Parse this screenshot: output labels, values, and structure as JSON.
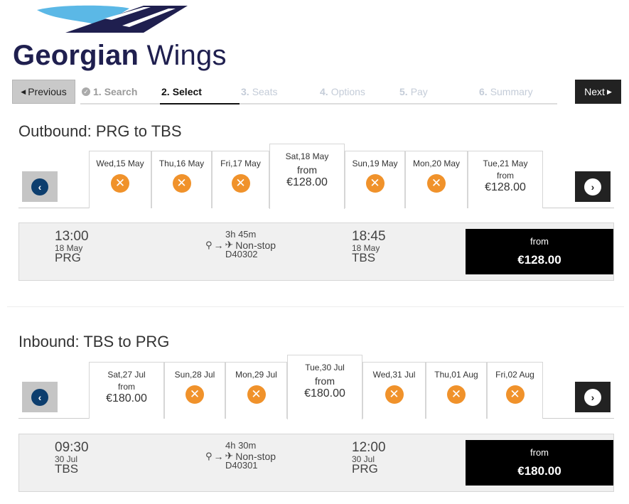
{
  "brand": {
    "name_bold": "Georgian",
    "name_light": "Wings"
  },
  "nav": {
    "previous_label": "Previous",
    "next_label": "Next",
    "steps": [
      {
        "num": "1.",
        "label": "Search",
        "state": "done"
      },
      {
        "num": "2.",
        "label": "Select",
        "state": "current"
      },
      {
        "num": "3.",
        "label": "Seats",
        "state": "todo"
      },
      {
        "num": "4.",
        "label": "Options",
        "state": "todo"
      },
      {
        "num": "5.",
        "label": "Pay",
        "state": "todo"
      },
      {
        "num": "6.",
        "label": "Summary",
        "state": "todo"
      }
    ]
  },
  "outbound": {
    "title": "Outbound: PRG to TBS",
    "days": [
      {
        "label": "Wed,15 May",
        "available": false
      },
      {
        "label": "Thu,16 May",
        "available": false
      },
      {
        "label": "Fri,17 May",
        "available": false
      },
      {
        "label": "Sat,18 May",
        "available": true,
        "selected": true,
        "from": "from",
        "price": "€128.00"
      },
      {
        "label": "Sun,19 May",
        "available": false
      },
      {
        "label": "Mon,20 May",
        "available": false
      },
      {
        "label": "Tue,21 May",
        "available": true,
        "from": "from",
        "price": "€128.00"
      }
    ],
    "flight": {
      "dep_time": "13:00",
      "dep_date": "18 May",
      "dep_code": "PRG",
      "duration": "3h 45m",
      "stops": "Non-stop",
      "flight_no": "D40302",
      "arr_time": "18:45",
      "arr_date": "18 May",
      "arr_code": "TBS",
      "price_from": "from",
      "price": "€128.00"
    }
  },
  "inbound": {
    "title": "Inbound: TBS to PRG",
    "days": [
      {
        "label": "Sat,27 Jul",
        "available": true,
        "from": "from",
        "price": "€180.00"
      },
      {
        "label": "Sun,28 Jul",
        "available": false
      },
      {
        "label": "Mon,29 Jul",
        "available": false
      },
      {
        "label": "Tue,30 Jul",
        "available": true,
        "selected": true,
        "from": "from",
        "price": "€180.00"
      },
      {
        "label": "Wed,31 Jul",
        "available": false
      },
      {
        "label": "Thu,01 Aug",
        "available": false
      },
      {
        "label": "Fri,02 Aug",
        "available": false
      }
    ],
    "flight": {
      "dep_time": "09:30",
      "dep_date": "30 Jul",
      "dep_code": "TBS",
      "duration": "4h 30m",
      "stops": "Non-stop",
      "flight_no": "D40301",
      "arr_time": "12:00",
      "arr_date": "30 Jul",
      "arr_code": "PRG",
      "price_from": "from",
      "price": "€180.00"
    }
  },
  "colors": {
    "brand_navy": "#1f1f4f",
    "brand_blue": "#5bb8e6",
    "unavailable_orange": "#f0922b",
    "price_box": "#000000"
  }
}
